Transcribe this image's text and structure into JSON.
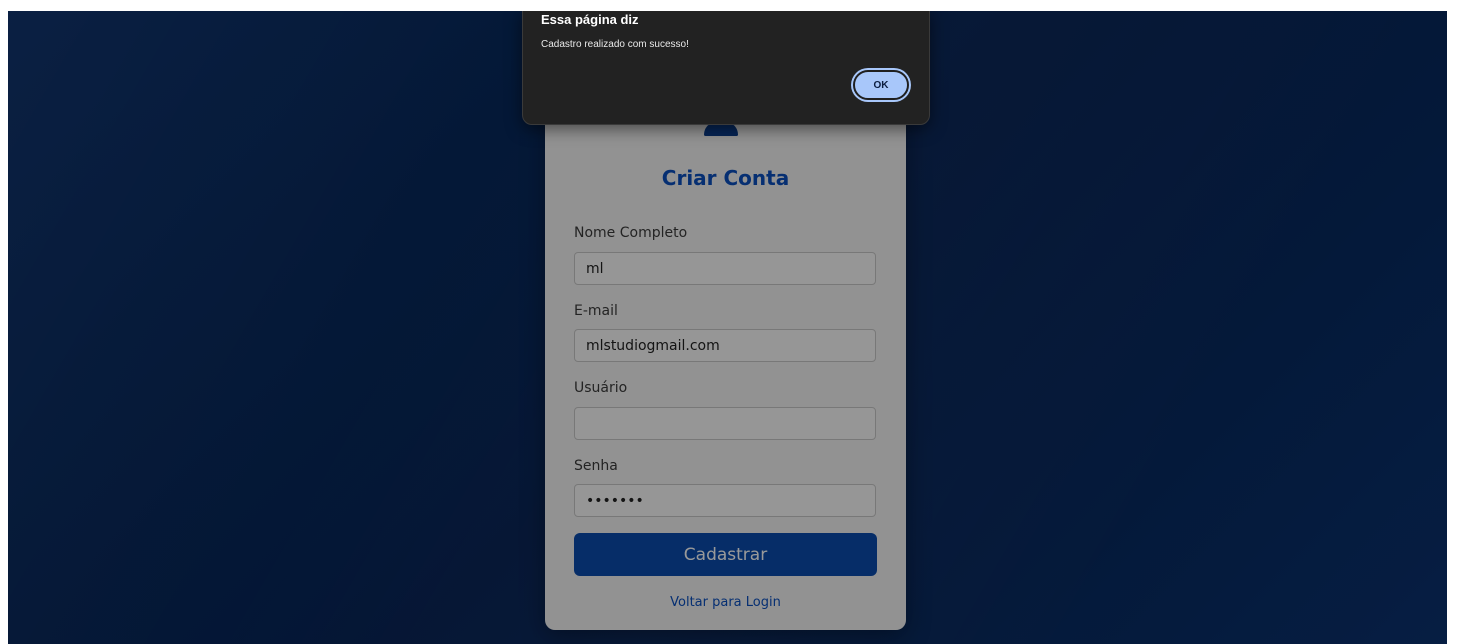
{
  "form": {
    "title": "Criar Conta",
    "fields": [
      {
        "label": "Nome Completo",
        "value": "ml",
        "type": "text"
      },
      {
        "label": "E-mail",
        "value": "mlstudiogmail.com",
        "type": "text"
      },
      {
        "label": "Usuário",
        "value": "",
        "type": "text"
      },
      {
        "label": "Senha",
        "value": "•••••••",
        "type": "password"
      }
    ],
    "submit_label": "Cadastrar",
    "back_link": "Voltar para Login"
  },
  "alert": {
    "title": "Essa página diz",
    "message": "Cadastro realizado com sucesso!",
    "ok_label": "OK"
  },
  "colors": {
    "background": "#082a5e",
    "accent": "#0a4cae",
    "dialog": "#222222",
    "ok_button": "#a8c7fa"
  }
}
